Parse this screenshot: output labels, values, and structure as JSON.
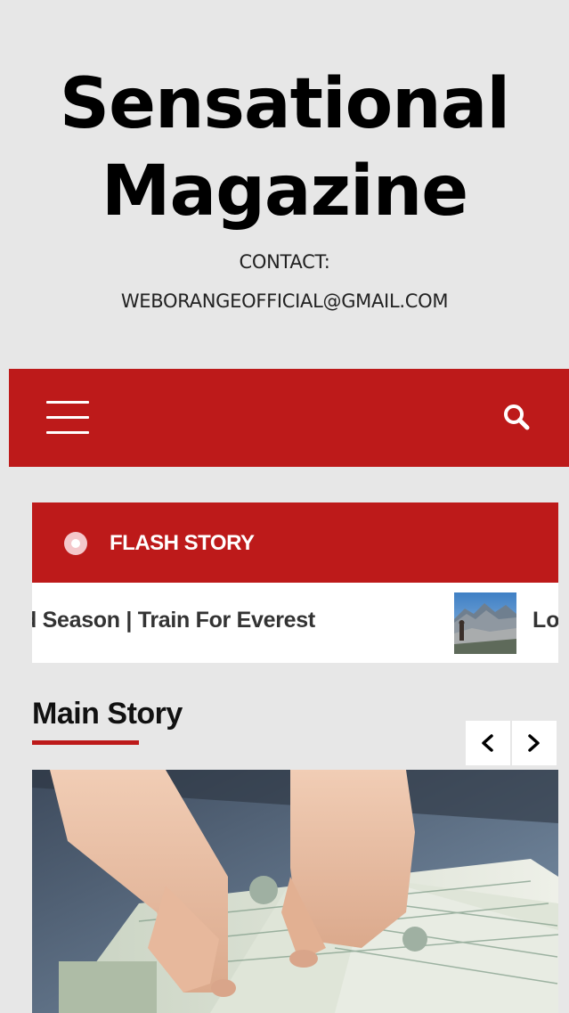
{
  "header": {
    "title_line1": "Sensational",
    "title_line2": "Magazine",
    "contact_line1": "CONTACT:",
    "contact_line2": "WEBORANGEOFFICIAL@GMAIL.COM"
  },
  "nav": {
    "menu_icon": "hamburger-icon",
    "search_icon": "search-icon"
  },
  "flash": {
    "label": "FLASH STORY",
    "ticker_items": [
      "d Season | Train For Everest",
      "Lo"
    ]
  },
  "main_story": {
    "heading": "Main Story",
    "prev_icon": "chevron-left-icon",
    "next_icon": "chevron-right-icon"
  },
  "colors": {
    "accent": "#bd1a1a",
    "background": "#e7e7e7",
    "flash_dot": "#f4c8cb"
  }
}
